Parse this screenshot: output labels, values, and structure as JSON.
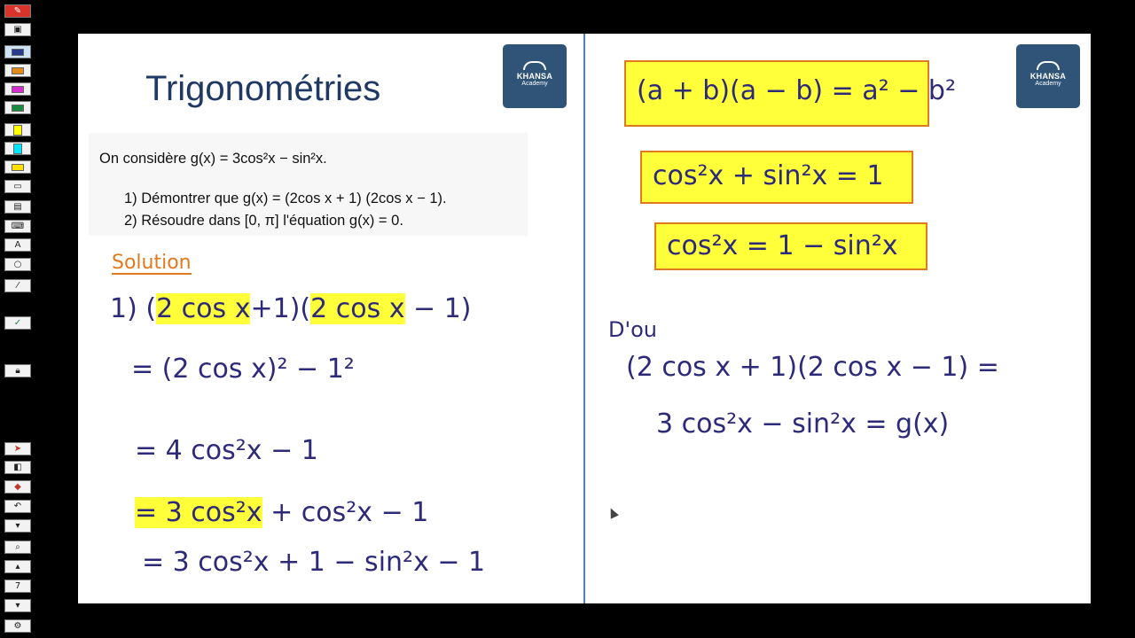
{
  "toolbar": {
    "pen_icon": "pen-logo-icon",
    "zoom_value": "7",
    "pen_colors": [
      "#2a3b8f",
      "#e08b1a",
      "#d42ed1",
      "#1b8a3e"
    ],
    "highlighter_colors": [
      "#ffff00",
      "#00e5ff",
      "#ffe100"
    ]
  },
  "left_page": {
    "title": "Trigonométries",
    "logo": {
      "line1": "KHANSA",
      "line2": "Academy"
    },
    "problem": {
      "statement": "On considère g(x) = 3cos²x − sin²x.",
      "items": [
        "1)   Démontrer que g(x) = (2cos x + 1) (2cos x − 1).",
        "2)   Résoudre dans [0, π] l'équation g(x) = 0."
      ]
    },
    "solution_label": "Solution",
    "steps": {
      "s1_num": "1)",
      "s1_a": "(",
      "s1_b": "2 cos x",
      "s1_c": "+1)(",
      "s1_d": "2 cos x",
      "s1_e": " − 1)",
      "s2": "= (2 cos x)² − 1²",
      "s3": "= 4 cos²x  − 1",
      "s4_hl": "= 3 cos²x",
      "s4_rest": " + cos²x  − 1",
      "s5": "= 3 cos²x + 1 − sin²x − 1"
    }
  },
  "right_page": {
    "logo": {
      "line1": "KHANSA",
      "line2": "Academy"
    },
    "formulas": [
      "(a + b)(a − b) = a² − b²",
      "cos²x + sin²x = 1",
      "cos²x = 1 − sin²x"
    ],
    "dou": "D'ou",
    "r1": "(2 cos x + 1)(2 cos x − 1) =",
    "r2": "3 cos²x  − sin²x  = g(x)"
  },
  "colors": {
    "accent": "#1f3864",
    "ink": "#2d2a7a",
    "highlight": "#ffff3a",
    "box_border": "#e07a1f",
    "logo_bg": "#2f5478",
    "solution_label": "#e07a1f"
  }
}
